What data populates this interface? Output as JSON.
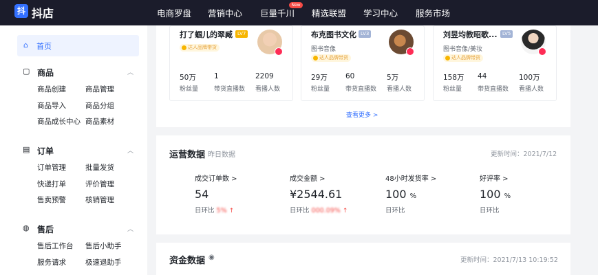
{
  "topbar": {
    "logo_glyph": "抖",
    "brand": "抖店",
    "nav": [
      "电商罗盘",
      "营销中心",
      "巨量千川",
      "精选联盟",
      "学习中心",
      "服务市场"
    ],
    "nav_badge": "New"
  },
  "sidebar": {
    "home": {
      "icon": "home-icon",
      "label": "首页"
    },
    "groups": [
      {
        "icon": "shop-bag-icon",
        "label": "商品",
        "caret": "^",
        "links": [
          "商品创建",
          "商品管理",
          "商品导入",
          "商品分组",
          "商品成长中心",
          "商品素材"
        ]
      },
      {
        "icon": "clipboard-icon",
        "label": "订单",
        "caret": "^",
        "links": [
          "订单管理",
          "批量发货",
          "快递打单",
          "评价管理",
          "售卖预警",
          "核销管理"
        ]
      },
      {
        "icon": "service-icon",
        "label": "售后",
        "caret": "^",
        "links": [
          "售后工作台",
          "售后小助手",
          "服务请求",
          "极速退助手",
          "",
          ""
        ]
      }
    ]
  },
  "anchors": [
    {
      "name": "打了蝈儿的翠臧",
      "level": "LV7",
      "level_color": "#f7b500",
      "sub": "",
      "badge": "达人品牌带货",
      "stats": [
        {
          "value": "50万",
          "label": "粉丝量"
        },
        {
          "value": "1",
          "label": "带货直播数"
        },
        {
          "value": "2209",
          "label": "看播人数"
        }
      ]
    },
    {
      "name": "布克图书文化",
      "level": "LV3",
      "level_color": "#a3b4d6",
      "sub": "图书音像",
      "badge": "达人品牌带货",
      "stats": [
        {
          "value": "29万",
          "label": "粉丝量"
        },
        {
          "value": "60",
          "label": "带货直播数"
        },
        {
          "value": "5万",
          "label": "看播人数"
        }
      ]
    },
    {
      "name": "刘昱均教昭歌...",
      "level": "LV5",
      "level_color": "#a3b4d6",
      "sub": "图书音像/美妆",
      "badge": "达人品牌带货",
      "stats": [
        {
          "value": "158万",
          "label": "粉丝量"
        },
        {
          "value": "44",
          "label": "带货直播数"
        },
        {
          "value": "100万",
          "label": "看播人数"
        }
      ]
    }
  ],
  "more_link": "查看更多 >",
  "operations": {
    "title": "运营数据",
    "sub": "昨日数据",
    "update": "更新时间：2021/7/12",
    "metrics": [
      {
        "label": "成交订单数 >",
        "value": "54",
        "unit": "",
        "cmp_label": "日环比",
        "cmp_value": "5%",
        "arrow": "↑"
      },
      {
        "label": "成交金额 >",
        "value": "¥2544.61",
        "unit": "",
        "cmp_label": "日环比",
        "cmp_value": "000.09%",
        "arrow": "↑"
      },
      {
        "label": "48小时发货率 >",
        "value": "100",
        "unit": "%",
        "cmp_label": "日环比",
        "cmp_value": "",
        "arrow": ""
      },
      {
        "label": "好评率 >",
        "value": "100",
        "unit": "%",
        "cmp_label": "日环比",
        "cmp_value": "",
        "arrow": ""
      }
    ]
  },
  "funds": {
    "title": "资金数据",
    "update": "更新时间：2021/7/13 10:19:52"
  }
}
